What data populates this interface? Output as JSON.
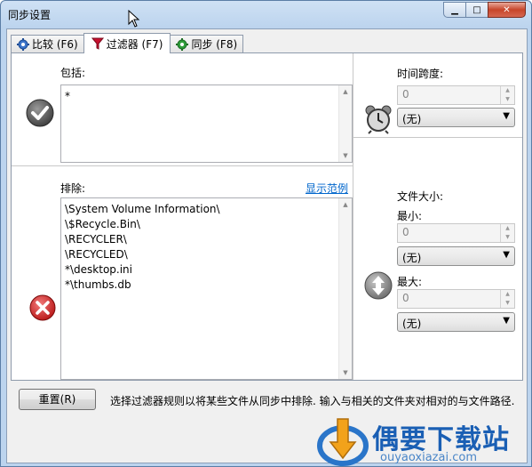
{
  "window": {
    "title": "同步设置"
  },
  "tabs": [
    {
      "label": "比较 (F6)"
    },
    {
      "label": "过滤器 (F7)"
    },
    {
      "label": "同步 (F8)"
    }
  ],
  "include": {
    "label": "包括:",
    "value": "*"
  },
  "exclude": {
    "label": "排除:",
    "example_link": "显示范例",
    "lines": [
      "\\System Volume Information\\",
      "\\$Recycle.Bin\\",
      "\\RECYCLER\\",
      "\\RECYCLED\\",
      "*\\desktop.ini",
      "*\\thumbs.db"
    ]
  },
  "timespan": {
    "label": "时间跨度:",
    "value": "0",
    "unit": "(无)"
  },
  "filesize": {
    "label": "文件大小:",
    "min_label": "最小:",
    "min_value": "0",
    "min_unit": "(无)",
    "max_label": "最大:",
    "max_value": "0",
    "max_unit": "(无)"
  },
  "footer": {
    "reset_label": "重置(R)",
    "hint": "选择过滤器规则以将某些文件从同步中排除. 输入与相关的文件夹对相对的与文件路径."
  },
  "watermark": {
    "name": "偶要下载站",
    "url": "ouyaoxiazai.com"
  }
}
